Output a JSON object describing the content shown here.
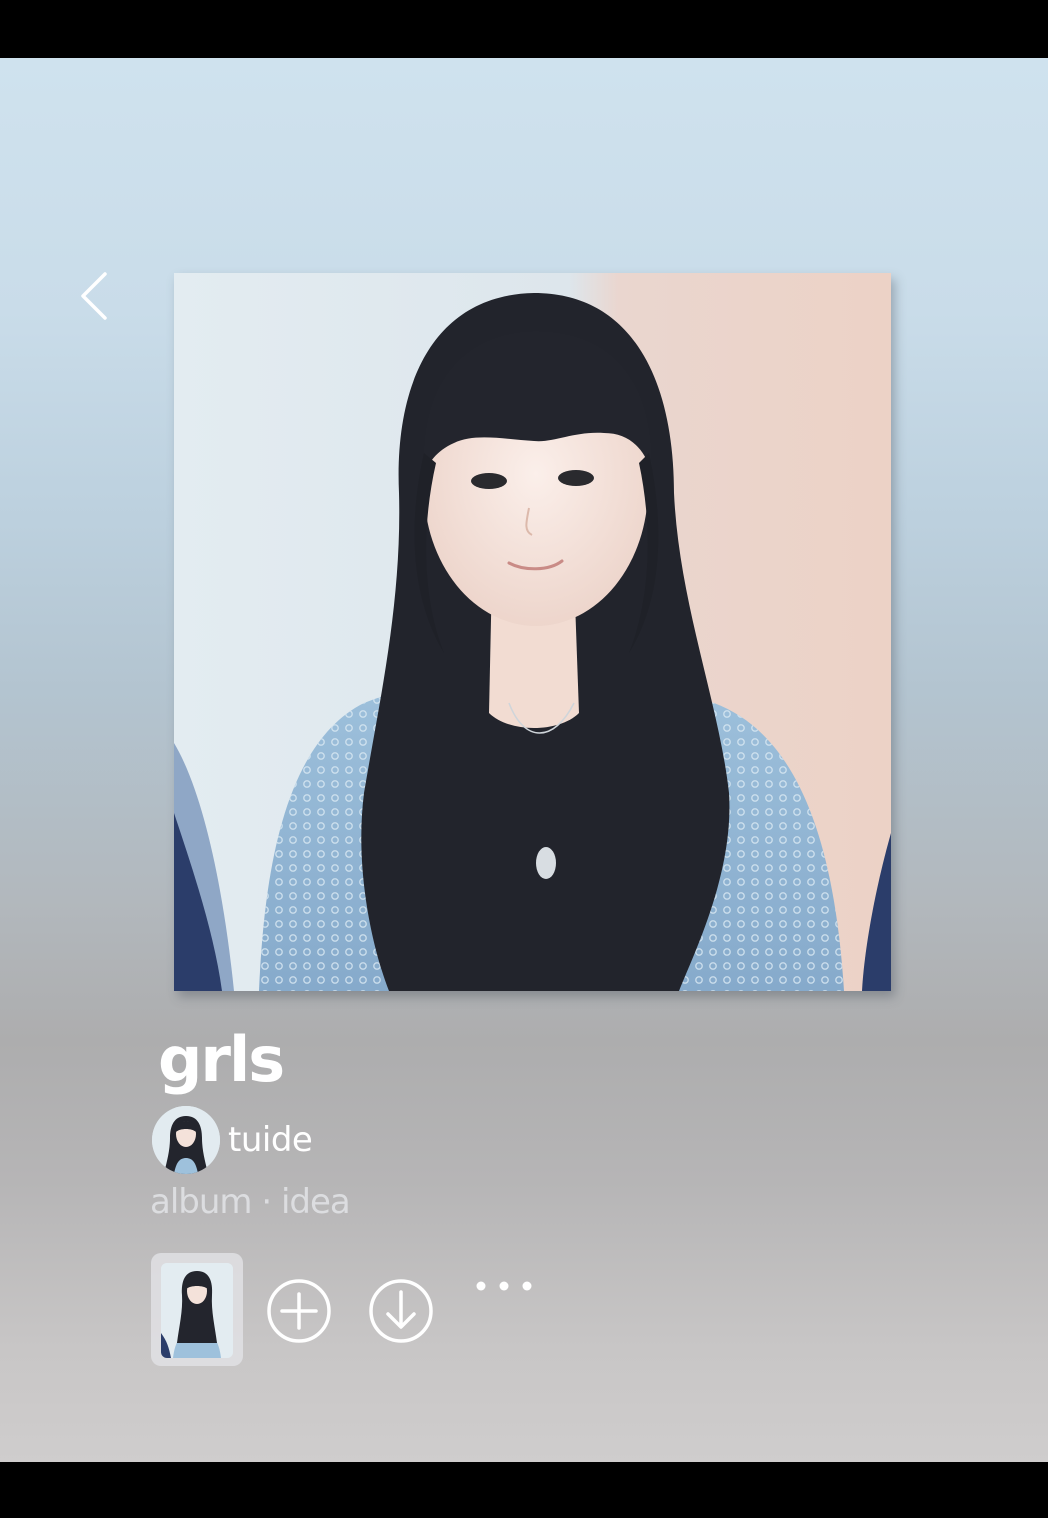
{
  "album": {
    "title": "grls",
    "owner": "tuide",
    "meta": "album · idea"
  },
  "icons": {
    "back": "chevron-left-icon",
    "add": "add-circle-icon",
    "download": "download-circle-icon",
    "more": "more-horizontal-icon"
  },
  "colors": {
    "gradient_top": "#cfe2ee",
    "gradient_bottom": "#cfcdcd",
    "text_primary": "#ffffff",
    "text_secondary": "#dcdde0"
  }
}
